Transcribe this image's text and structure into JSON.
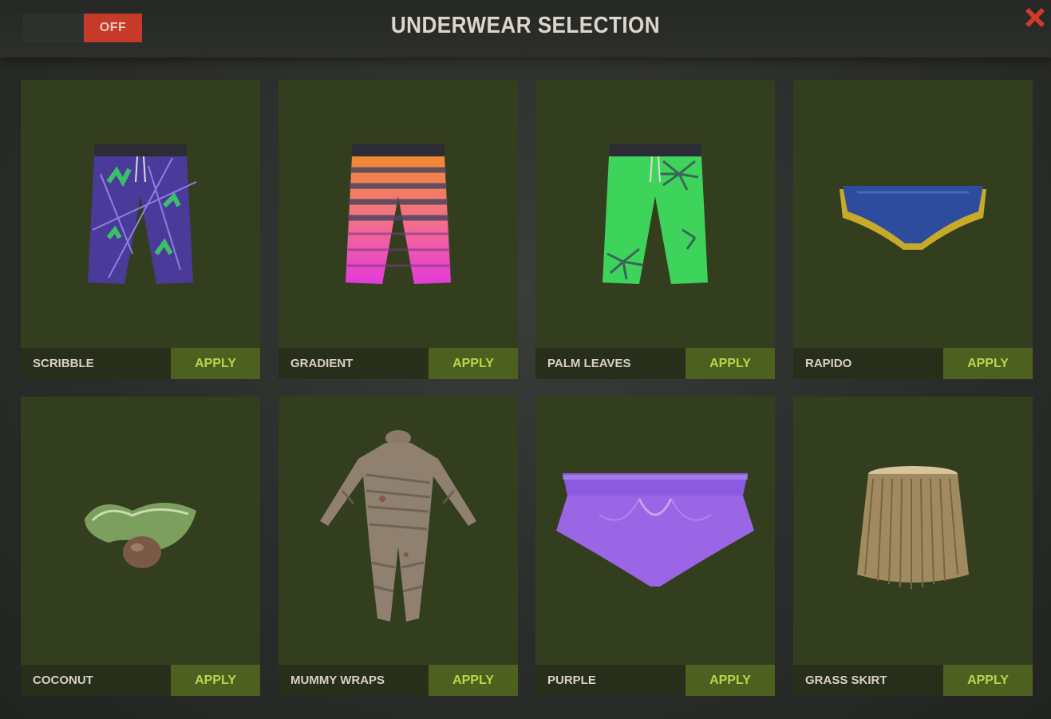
{
  "header": {
    "toggle_label": "OFF",
    "title": "UNDERWEAR SELECTION",
    "close_icon": "close-x-icon"
  },
  "colors": {
    "accent_red": "#c63a2a",
    "card_bg": "#333e1f",
    "apply_bg": "#4d601f",
    "apply_text": "#b3d84a"
  },
  "items": [
    {
      "name": "SCRIBBLE",
      "apply": "APPLY",
      "icon": "scribble-shorts-icon"
    },
    {
      "name": "GRADIENT",
      "apply": "APPLY",
      "icon": "gradient-shorts-icon"
    },
    {
      "name": "PALM LEAVES",
      "apply": "APPLY",
      "icon": "palm-leaves-shorts-icon"
    },
    {
      "name": "RAPIDO",
      "apply": "APPLY",
      "icon": "rapido-briefs-icon"
    },
    {
      "name": "COCONUT",
      "apply": "APPLY",
      "icon": "coconut-bikini-icon"
    },
    {
      "name": "MUMMY WRAPS",
      "apply": "APPLY",
      "icon": "mummy-wraps-suit-icon"
    },
    {
      "name": "PURPLE",
      "apply": "APPLY",
      "icon": "purple-briefs-icon"
    },
    {
      "name": "GRASS SKIRT",
      "apply": "APPLY",
      "icon": "grass-skirt-icon"
    }
  ]
}
